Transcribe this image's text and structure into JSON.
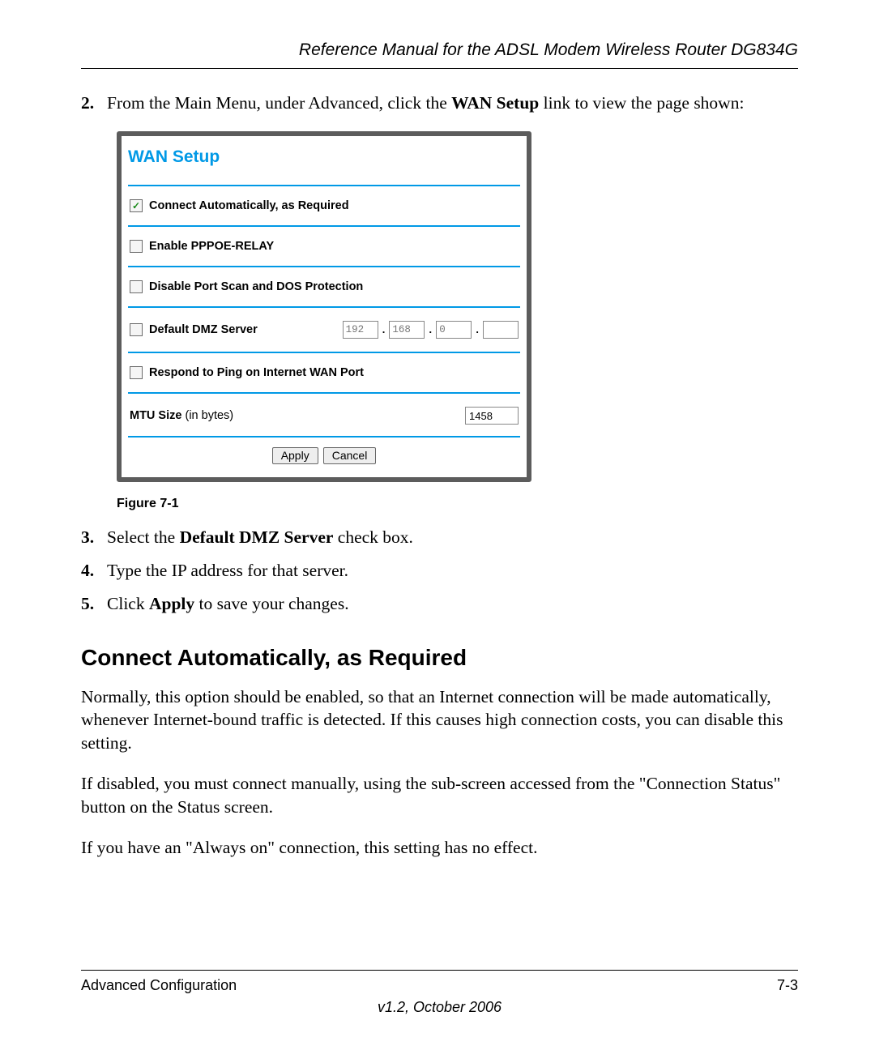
{
  "doc_title": "Reference Manual for the ADSL Modem Wireless Router DG834G",
  "steps": {
    "s2_num": "2.",
    "s2_a": "From the Main Menu, under Advanced, click the ",
    "s2_b": "WAN Setup",
    "s2_c": " link to view the page shown:",
    "s3_num": "3.",
    "s3_a": "Select the ",
    "s3_b": "Default DMZ Server",
    "s3_c": " check box.",
    "s4_num": "4.",
    "s4_a": "Type the IP address for that server.",
    "s5_num": "5.",
    "s5_a": "Click ",
    "s5_b": "Apply",
    "s5_c": " to save your changes."
  },
  "panel": {
    "title": "WAN Setup",
    "connect_auto": "Connect Automatically, as Required",
    "pppoe": "Enable PPPOE-RELAY",
    "disable_port": "Disable Port Scan and DOS Protection",
    "dmz": "Default DMZ Server",
    "respond_ping": "Respond to Ping on Internet WAN Port",
    "mtu_label_a": "MTU Size ",
    "mtu_label_b": "(in bytes)",
    "ip": {
      "a": "192",
      "b": "168",
      "c": "0",
      "d": ""
    },
    "mtu_value": "1458",
    "apply": "Apply",
    "cancel": "Cancel"
  },
  "fig_caption": "Figure 7-1",
  "section_heading": "Connect Automatically, as Required",
  "body": {
    "p1": "Normally, this option should be enabled, so that an Internet connection will be made automatically, whenever Internet-bound traffic is detected. If this causes high connection costs, you can disable this setting.",
    "p2": "If disabled, you must connect manually, using the sub-screen accessed from the \"Connection Status\" button on the Status screen.",
    "p3": "If you have an \"Always on\" connection, this setting has no effect."
  },
  "footer": {
    "left": "Advanced Configuration",
    "right": "7-3",
    "version": "v1.2, October 2006"
  }
}
